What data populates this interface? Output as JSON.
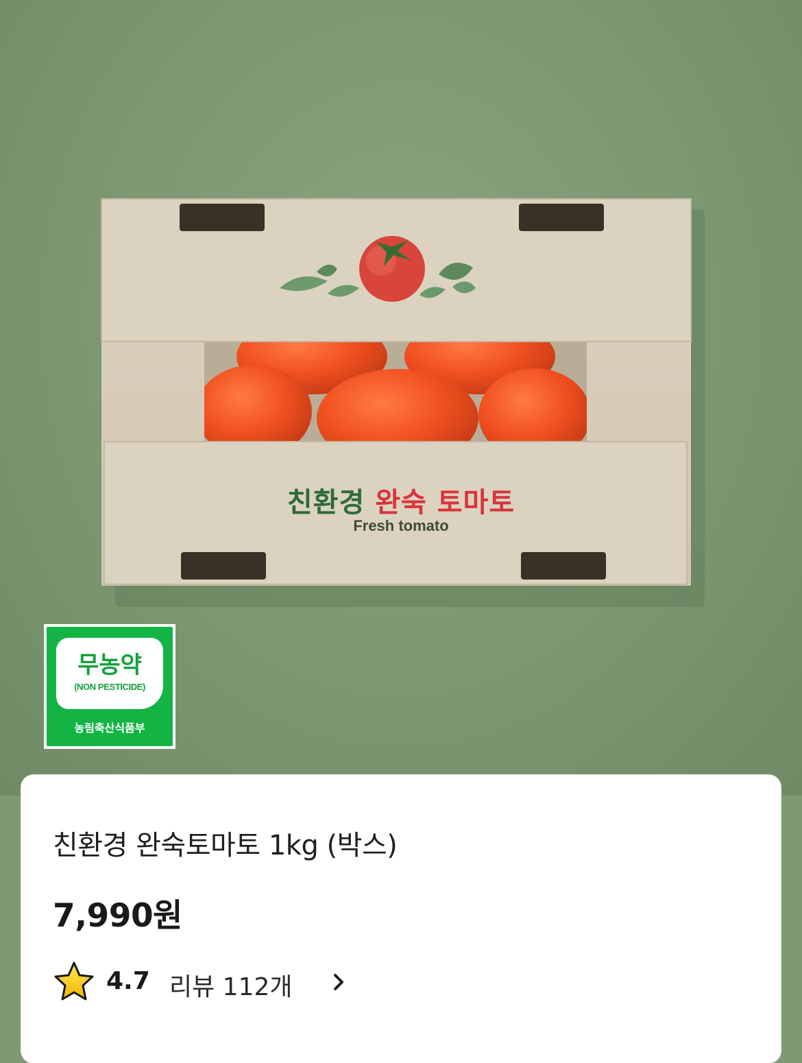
{
  "image": {
    "alt_icon": "tomato-box-photo",
    "box_label_green": "친환경",
    "box_label_red": "완숙 토마토",
    "box_label_en": "Fresh tomato"
  },
  "badge": {
    "main": "무농약",
    "sub": "(NON PESTICIDE)",
    "ministry": "농림축산식품부",
    "color": "#14b444"
  },
  "product": {
    "title": "친환경 완숙토마토 1kg (박스)",
    "price": "7,990원"
  },
  "rating": {
    "icon": "star-icon",
    "value": "4.7",
    "review_label": "리뷰 112개",
    "chevron_icon": "chevron-right-icon"
  }
}
